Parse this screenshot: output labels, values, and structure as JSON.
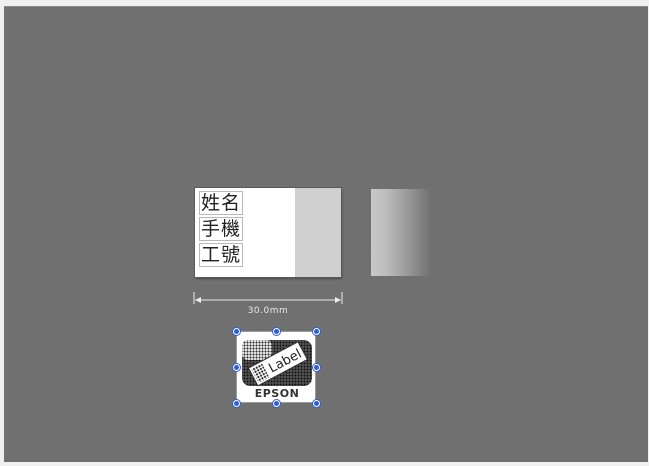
{
  "label": {
    "lines": [
      "姓名",
      "手機",
      "工號"
    ]
  },
  "dimension": {
    "width_text": "30.0mm"
  },
  "logo": {
    "brand": "EPSON",
    "product": "Label"
  },
  "colors": {
    "workspace": "#707070",
    "label_background": "#ffffff",
    "margin": "#cfcfcf",
    "selection_handle": "#2f5fd8"
  },
  "icons": {
    "logo": "label-works-logo-icon",
    "handles": "resize-handle-icon"
  }
}
